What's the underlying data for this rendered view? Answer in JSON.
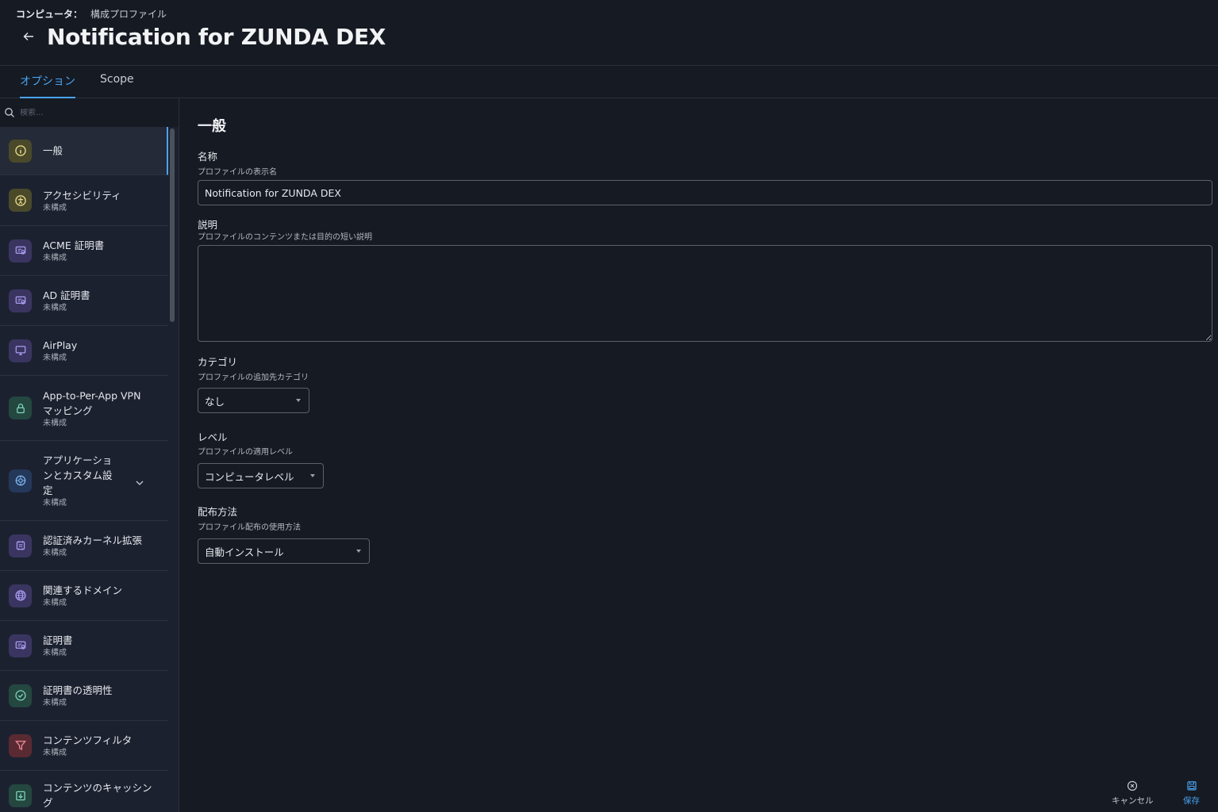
{
  "breadcrumb": {
    "root": "コンピュータ：",
    "current": "構成プロファイル"
  },
  "title": "Notification for ZUNDA DEX",
  "tabs": {
    "options": "オプション",
    "scope": "Scope"
  },
  "sidebar": {
    "search_placeholder": "検索...",
    "items": [
      {
        "label": "一般",
        "sub": "",
        "icon": "info-icon",
        "color": "#4a4a2a"
      },
      {
        "label": "アクセシビリティ",
        "sub": "未構成",
        "icon": "accessibility-icon",
        "color": "#4a4a2a"
      },
      {
        "label": "ACME 証明書",
        "sub": "未構成",
        "icon": "certificate-icon",
        "color": "#3a3560"
      },
      {
        "label": "AD 証明書",
        "sub": "未構成",
        "icon": "certificate-icon",
        "color": "#3a3560"
      },
      {
        "label": "AirPlay",
        "sub": "未構成",
        "icon": "airplay-icon",
        "color": "#3a3560"
      },
      {
        "label": "App-to-Per-App VPN マッピング",
        "sub": "未構成",
        "icon": "lock-icon",
        "color": "#24473f"
      },
      {
        "label": "アプリケーションとカスタム設定",
        "sub": "未構成",
        "icon": "gear-icon",
        "color": "#24385a"
      },
      {
        "label": "認証済みカーネル拡張",
        "sub": "未構成",
        "icon": "kernel-icon",
        "color": "#3a3560"
      },
      {
        "label": "関連するドメイン",
        "sub": "未構成",
        "icon": "globe-icon",
        "color": "#3a3560"
      },
      {
        "label": "証明書",
        "sub": "未構成",
        "icon": "certificate-icon",
        "color": "#3a3560"
      },
      {
        "label": "証明書の透明性",
        "sub": "未構成",
        "icon": "check-circle-icon",
        "color": "#24473f"
      },
      {
        "label": "コンテンツフィルタ",
        "sub": "未構成",
        "icon": "filter-icon",
        "color": "#5a2a32"
      },
      {
        "label": "コンテンツのキャッシング",
        "sub": "",
        "icon": "cache-icon",
        "color": "#24473f"
      }
    ]
  },
  "main": {
    "section_title": "一般",
    "name": {
      "label": "名称",
      "help": "プロファイルの表示名",
      "value": "Notification for ZUNDA DEX"
    },
    "description": {
      "label": "説明",
      "help": "プロファイルのコンテンツまたは目的の短い説明",
      "value": ""
    },
    "category": {
      "label": "カテゴリ",
      "help": "プロファイルの追加先カテゴリ",
      "value": "なし"
    },
    "level": {
      "label": "レベル",
      "help": "プロファイルの適用レベル",
      "value": "コンピュータレベル"
    },
    "distribution": {
      "label": "配布方法",
      "help": "プロファイル配布の使用方法",
      "value": "自動インストール"
    }
  },
  "footer": {
    "cancel": "キャンセル",
    "save": "保存"
  }
}
